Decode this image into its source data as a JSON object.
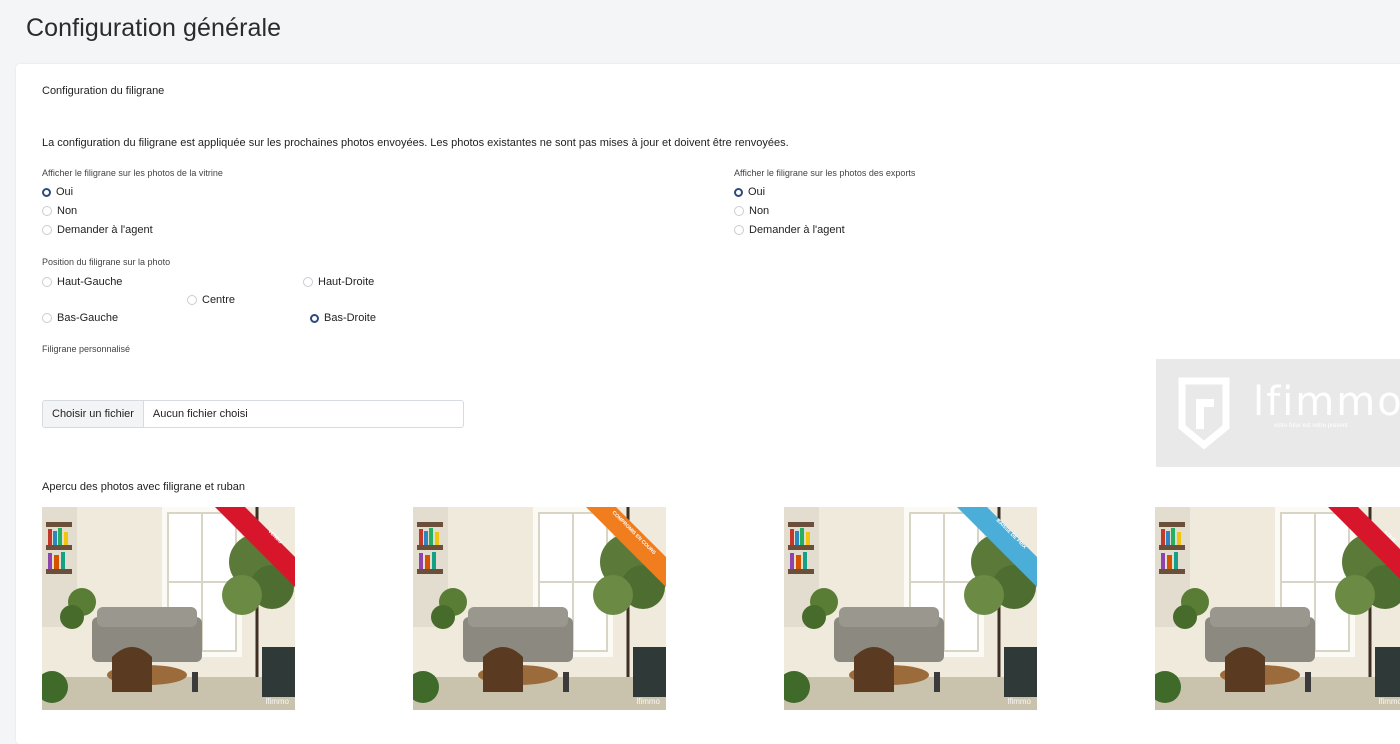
{
  "page": {
    "title": "Configuration générale"
  },
  "card": {
    "title": "Configuration du filigrane",
    "notice": "La configuration du filigrane est appliquée sur les prochaines photos envoyées. Les photos existantes ne sont pas mises à jour et doivent être renvoyées."
  },
  "vitrine": {
    "label": "Afficher le filigrane sur les photos de la vitrine",
    "options": [
      "Oui",
      "Non",
      "Demander à l'agent"
    ],
    "selected": "Oui"
  },
  "exports": {
    "label": "Afficher le filigrane sur les photos des exports",
    "options": [
      "Oui",
      "Non",
      "Demander à l'agent"
    ],
    "selected": "Oui"
  },
  "position": {
    "label": "Position du filigrane sur la photo",
    "options": [
      "Haut-Gauche",
      "Haut-Droite",
      "Centre",
      "Bas-Gauche",
      "Bas-Droite"
    ],
    "selected": "Bas-Droite"
  },
  "custom": {
    "label": "Filigrane personnalisé",
    "button": "Choisir un fichier",
    "status": "Aucun fichier choisi"
  },
  "logo": {
    "text": "lfimmo",
    "tagline": "votre futur est notre présent"
  },
  "preview": {
    "label": "Apercu des photos avec filigrane et ruban",
    "watermark": "lfimmo",
    "photos": [
      {
        "ribbon": "VENDU",
        "color": "#d8162b"
      },
      {
        "ribbon": "COMPROMIS EN COURS",
        "color": "#f07d1e"
      },
      {
        "ribbon": "BAISSE DE PRIX",
        "color": "#4aaed8"
      },
      {
        "ribbon": "LOUÉ",
        "color": "#d8162b"
      }
    ]
  }
}
